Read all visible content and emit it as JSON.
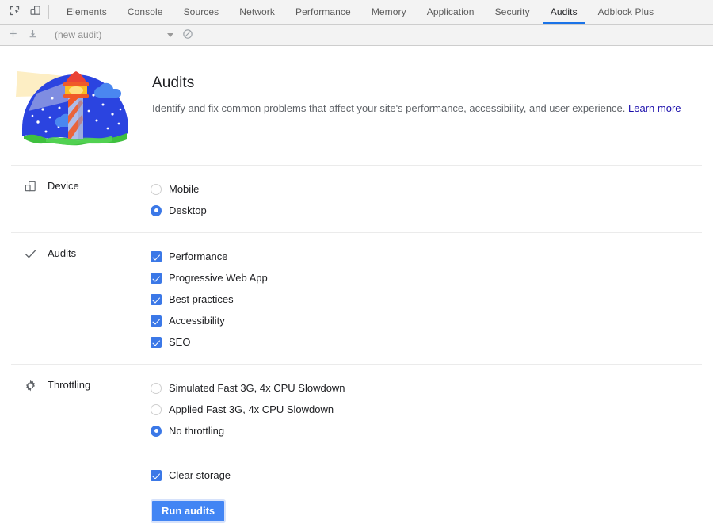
{
  "tabbar": {
    "inspect_icon": "inspect-cursor-icon",
    "device_toolbar_icon": "device-toolbar-icon",
    "tabs": [
      {
        "label": "Elements",
        "active": false
      },
      {
        "label": "Console",
        "active": false
      },
      {
        "label": "Sources",
        "active": false
      },
      {
        "label": "Network",
        "active": false
      },
      {
        "label": "Performance",
        "active": false
      },
      {
        "label": "Memory",
        "active": false
      },
      {
        "label": "Application",
        "active": false
      },
      {
        "label": "Security",
        "active": false
      },
      {
        "label": "Audits",
        "active": true
      },
      {
        "label": "Adblock Plus",
        "active": false
      }
    ],
    "active_tab": "Audits",
    "active_underline_color": "#1a73e8"
  },
  "audit_toolbar": {
    "new_audit_label": "+",
    "import_label": "import",
    "select_value": "(new audit)",
    "clear_label": "clear"
  },
  "hero": {
    "title": "Audits",
    "description": "Identify and fix common problems that affect your site's performance, accessibility, and user experience.",
    "learn_more": "Learn more",
    "link_color": "#1a0dab",
    "art_name": "lighthouse-illustration"
  },
  "sections": {
    "device": {
      "title": "Device",
      "icon": "device-icon",
      "options": [
        {
          "label": "Mobile",
          "checked": false
        },
        {
          "label": "Desktop",
          "checked": true
        }
      ]
    },
    "audits": {
      "title": "Audits",
      "icon": "checkmark-icon",
      "options": [
        {
          "label": "Performance",
          "checked": true
        },
        {
          "label": "Progressive Web App",
          "checked": true
        },
        {
          "label": "Best practices",
          "checked": true
        },
        {
          "label": "Accessibility",
          "checked": true
        },
        {
          "label": "SEO",
          "checked": true
        }
      ]
    },
    "throttling": {
      "title": "Throttling",
      "icon": "gear-icon",
      "options": [
        {
          "label": "Simulated Fast 3G, 4x CPU Slowdown",
          "checked": false
        },
        {
          "label": "Applied Fast 3G, 4x CPU Slowdown",
          "checked": false
        },
        {
          "label": "No throttling",
          "checked": true
        }
      ]
    }
  },
  "footer": {
    "clear_storage": {
      "label": "Clear storage",
      "checked": true
    },
    "run_button": "Run audits",
    "run_button_color": "#4285f4"
  }
}
